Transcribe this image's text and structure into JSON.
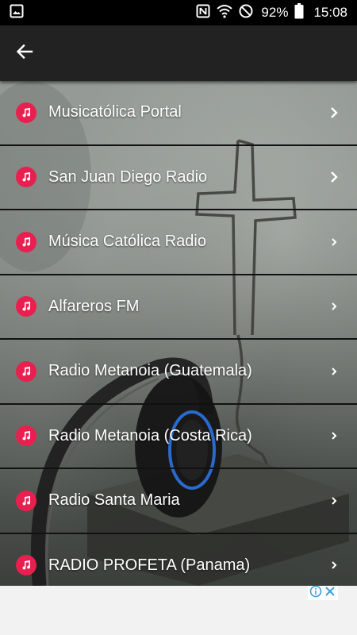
{
  "status_bar": {
    "battery_percent": "92%",
    "time": "15:08",
    "icons": [
      "image-icon",
      "nfc-icon",
      "wifi-icon",
      "do-not-disturb-icon",
      "battery-icon"
    ]
  },
  "app_bar": {
    "back_icon": "arrow-back-icon"
  },
  "stations": [
    {
      "label": "Musicatólica Portal",
      "icon": "music-note-icon",
      "chevron": "chevron-right-icon"
    },
    {
      "label": "San Juan Diego Radio",
      "icon": "music-note-icon",
      "chevron": "chevron-right-icon"
    },
    {
      "label": "Música Católica Radio",
      "icon": "music-note-icon",
      "chevron": "chevron-right-icon"
    },
    {
      "label": "Alfareros FM",
      "icon": "music-note-icon",
      "chevron": "chevron-right-icon"
    },
    {
      "label": "Radio Metanoia (Guatemala)",
      "icon": "music-note-icon",
      "chevron": "chevron-right-icon"
    },
    {
      "label": "Radio Metanoia (Costa Rica)",
      "icon": "music-note-icon",
      "chevron": "chevron-right-icon"
    },
    {
      "label": "Radio Santa Maria",
      "icon": "music-note-icon",
      "chevron": "chevron-right-icon"
    },
    {
      "label": "RADIO PROFETA (Panama)",
      "icon": "music-note-icon",
      "chevron": "chevron-right-icon"
    }
  ],
  "ad": {
    "icons": [
      "ad-info-icon",
      "ad-close-icon"
    ]
  },
  "colors": {
    "icon_accent": "#e8204f",
    "app_bar": "#222222",
    "status_bar": "#000000",
    "ad_badge": "#3aa0d8"
  }
}
